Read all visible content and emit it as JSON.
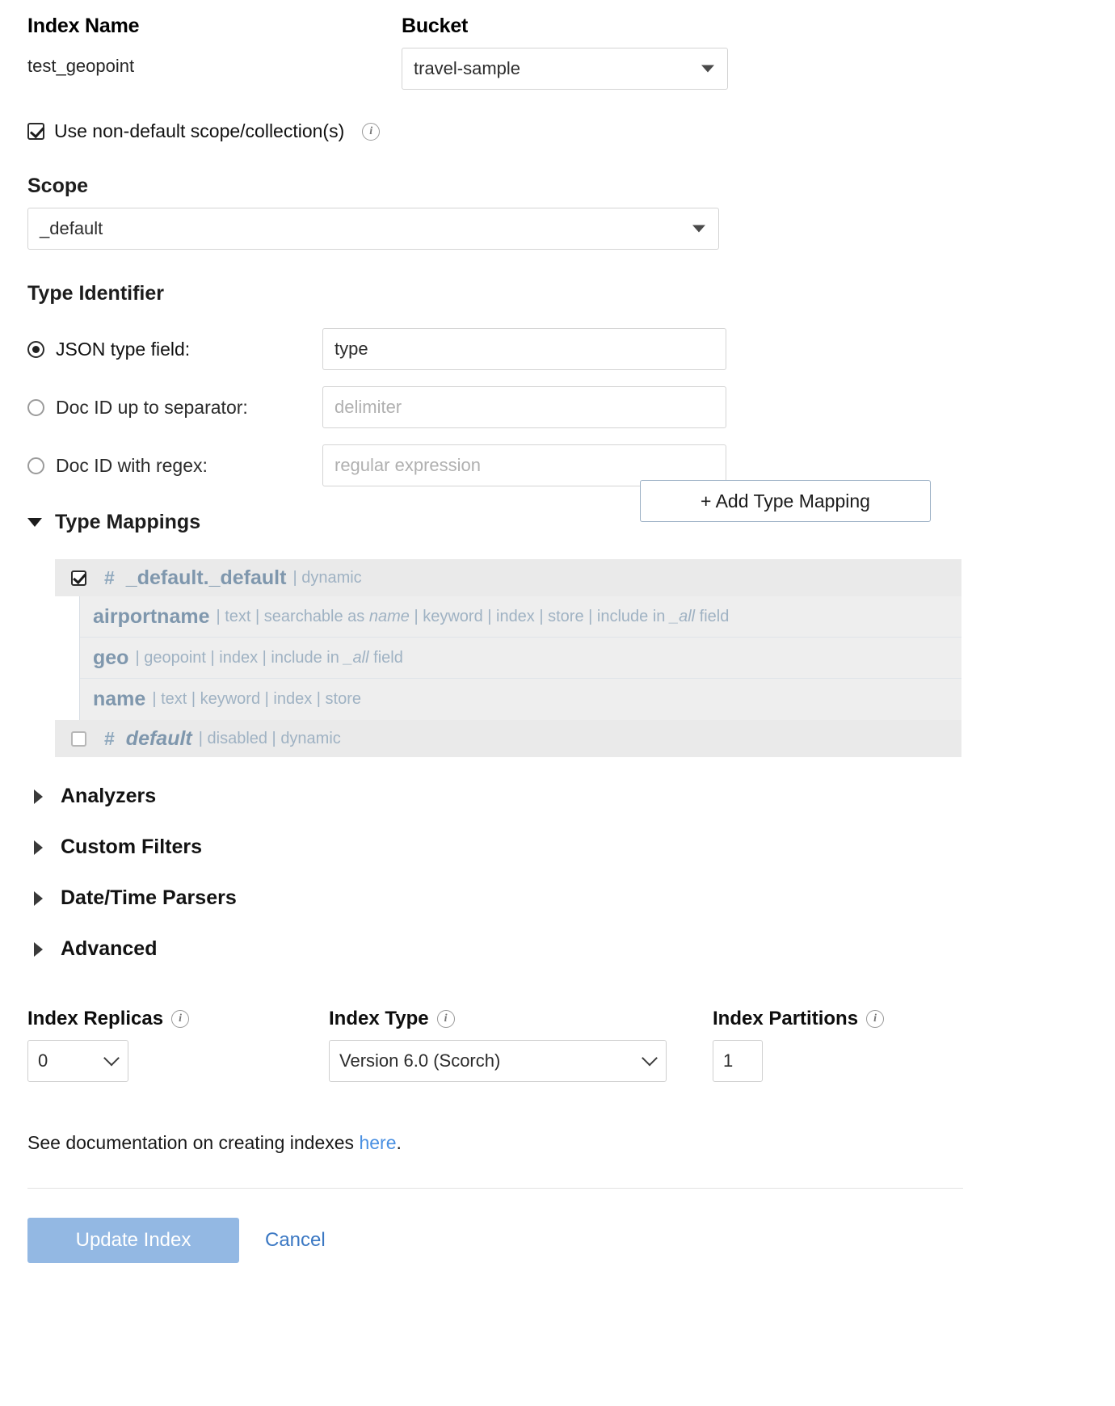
{
  "index_name": {
    "label": "Index Name",
    "value": "test_geopoint"
  },
  "bucket": {
    "label": "Bucket",
    "value": "travel-sample"
  },
  "non_default_scope": {
    "label": "Use non-default scope/collection(s)",
    "checked": true
  },
  "scope": {
    "label": "Scope",
    "value": "_default"
  },
  "type_identifier": {
    "label": "Type Identifier",
    "options": [
      {
        "label": "JSON type field:",
        "selected": true,
        "value": "type",
        "placeholder": ""
      },
      {
        "label": "Doc ID up to separator:",
        "selected": false,
        "value": "",
        "placeholder": "delimiter"
      },
      {
        "label": "Doc ID with regex:",
        "selected": false,
        "value": "",
        "placeholder": "regular expression"
      }
    ]
  },
  "type_mappings": {
    "label": "Type Mappings",
    "add_button": "+ Add Type Mapping",
    "mappings": [
      {
        "checked": true,
        "hash": "#",
        "name": "_default._default",
        "italic": false,
        "meta": "| dynamic",
        "fields": [
          {
            "name": "airportname",
            "parts": [
              "| text ",
              "| searchable as ",
              "name",
              " | keyword | index | store | include in ",
              "_all",
              " field"
            ]
          },
          {
            "name": "geo",
            "parts": [
              "| geopoint | index | include in ",
              "",
              "",
              "",
              "_all",
              " field"
            ]
          },
          {
            "name": "name",
            "parts": [
              "| text | keyword | index | store",
              "",
              "",
              "",
              "",
              ""
            ]
          }
        ]
      },
      {
        "checked": false,
        "hash": "#",
        "name": "default",
        "italic": true,
        "meta": "| disabled | dynamic",
        "fields": []
      }
    ]
  },
  "sections": [
    {
      "label": "Analyzers"
    },
    {
      "label": "Custom Filters"
    },
    {
      "label": "Date/Time Parsers"
    },
    {
      "label": "Advanced"
    }
  ],
  "settings": {
    "replicas": {
      "label": "Index Replicas",
      "value": "0"
    },
    "index_type": {
      "label": "Index Type",
      "value": "Version 6.0 (Scorch)"
    },
    "partitions": {
      "label": "Index Partitions",
      "value": "1"
    }
  },
  "footer": {
    "doc_prefix": "See documentation on creating indexes ",
    "doc_link": "here",
    "doc_suffix": ".",
    "update_button": "Update Index",
    "cancel_button": "Cancel"
  },
  "colors": {
    "accent_link": "#4a90e2",
    "primary_button": "#93b8e3",
    "mapping_name": "#7f97ad",
    "mapping_meta": "#9fb2c3"
  }
}
